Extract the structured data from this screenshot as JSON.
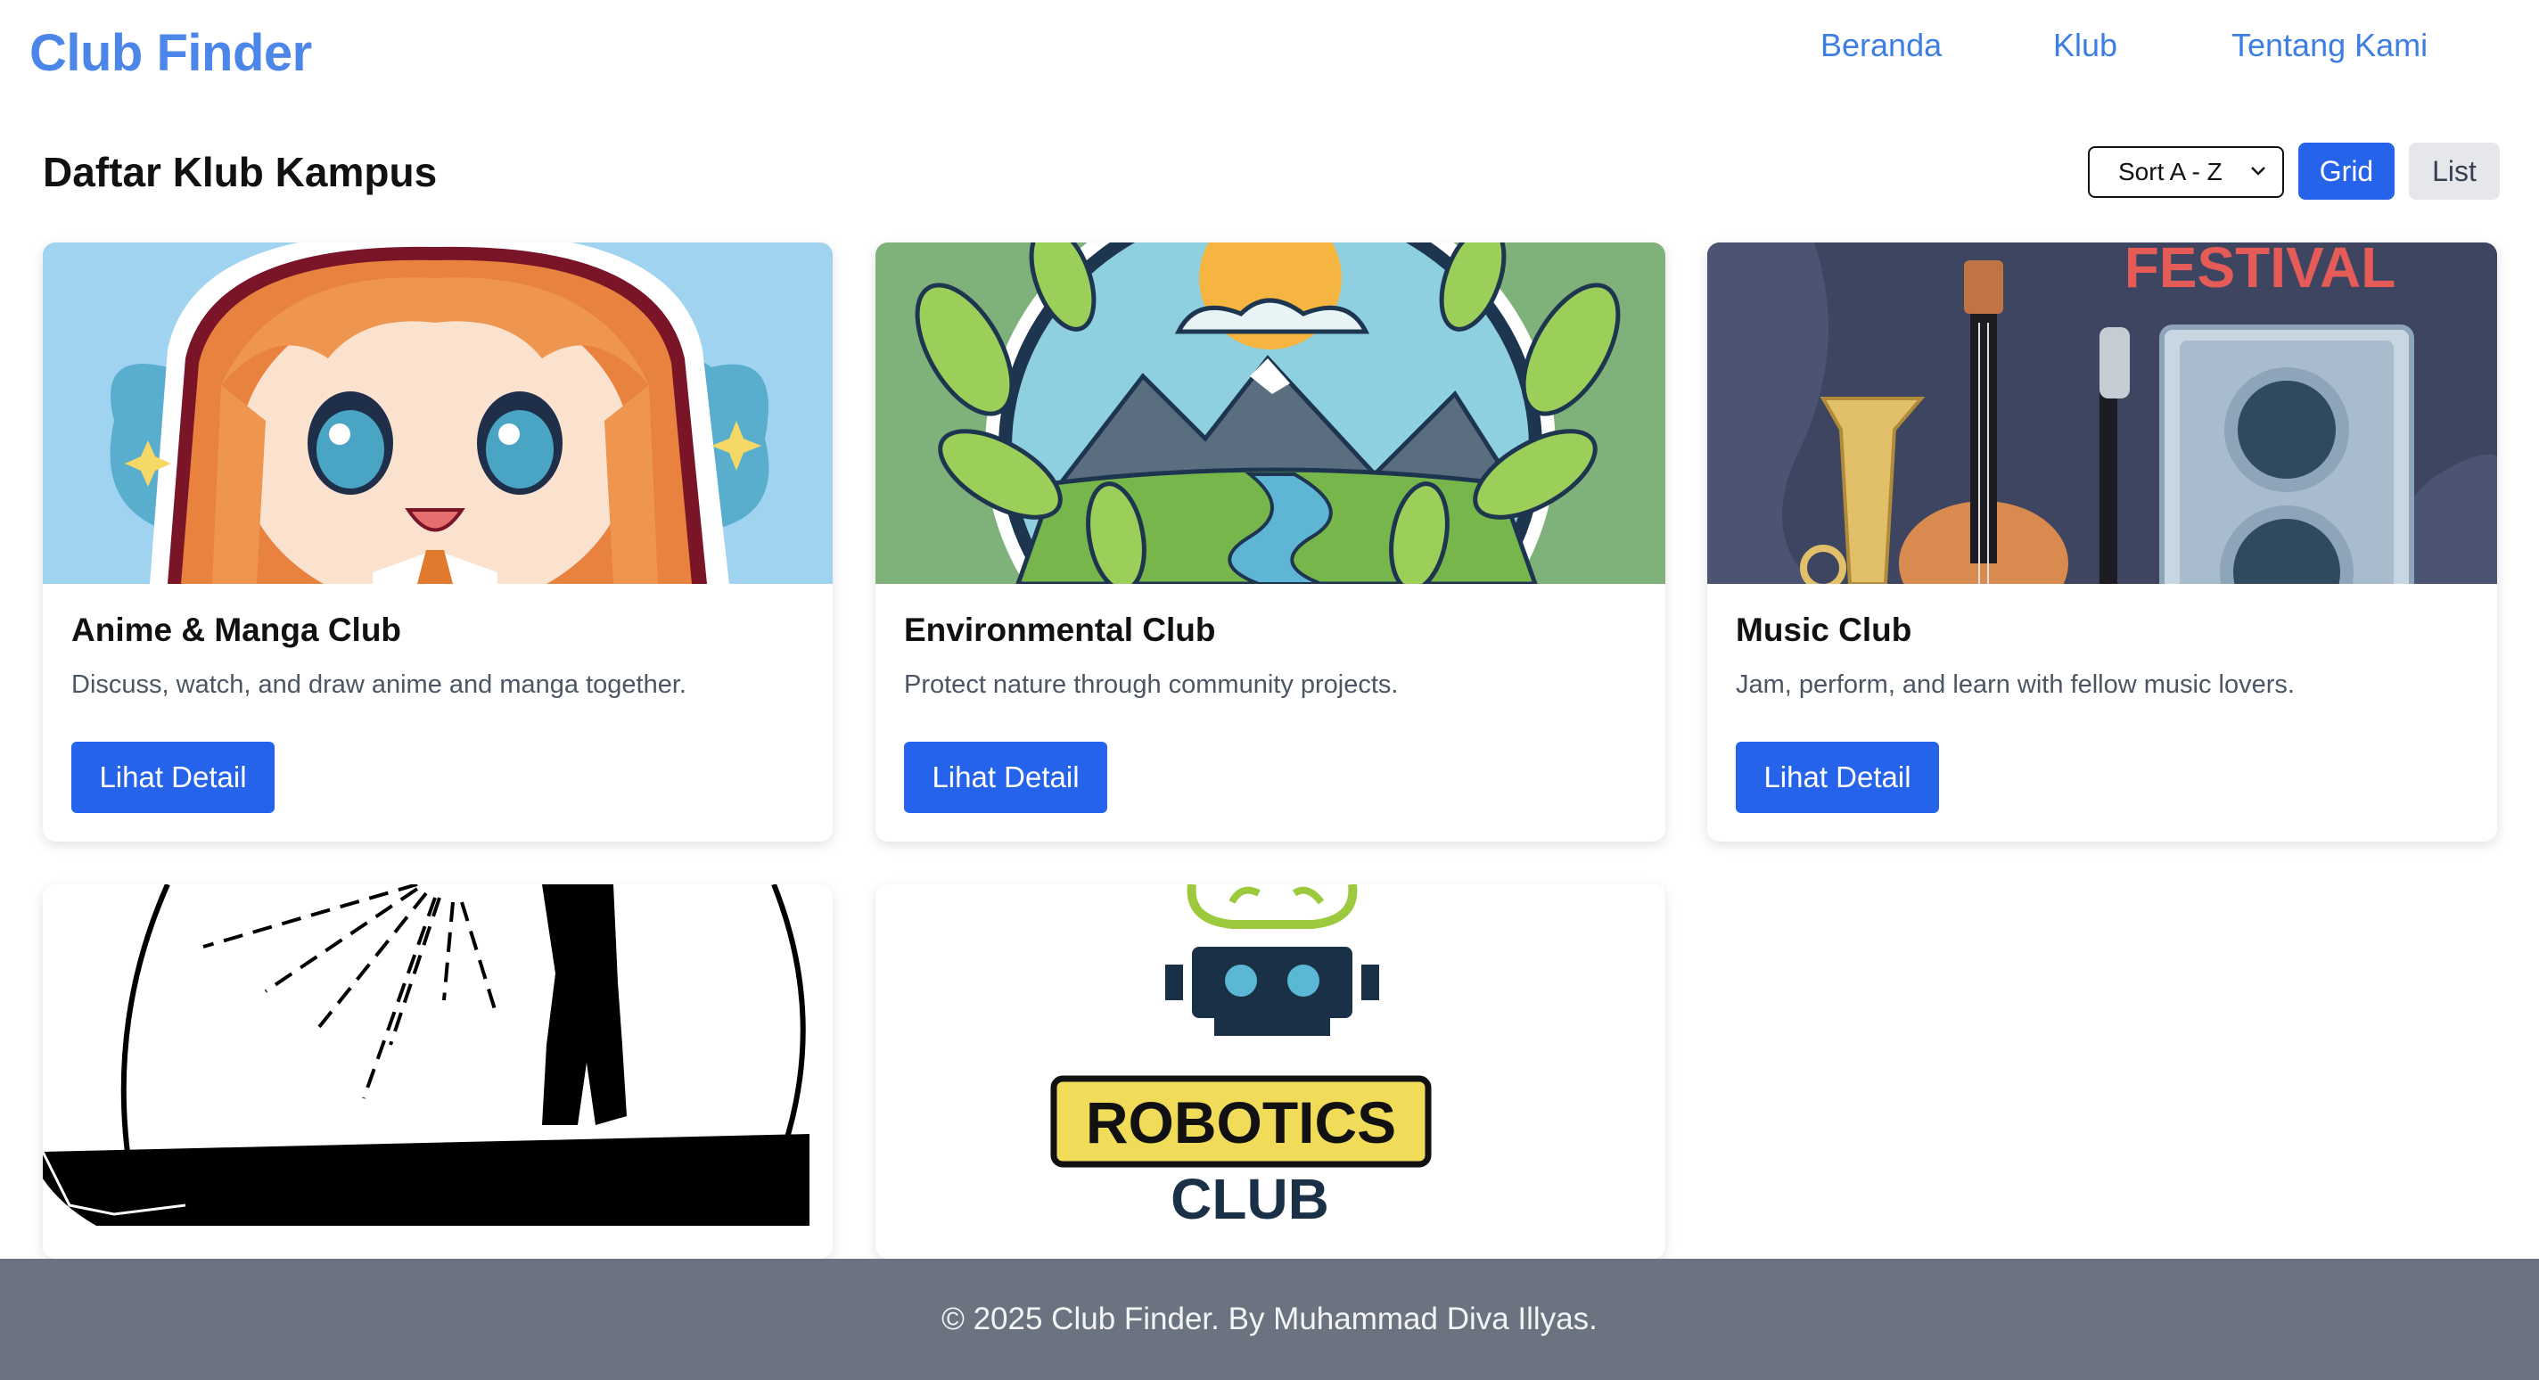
{
  "header": {
    "brand": "Club Finder",
    "nav": [
      "Beranda",
      "Klub",
      "Tentang Kami"
    ]
  },
  "toolbar": {
    "page_title": "Daftar Klub Kampus",
    "sort_value": "Sort A - Z",
    "grid_label": "Grid",
    "list_label": "List"
  },
  "clubs": [
    {
      "name": "Anime & Manga Club",
      "description": "Discuss, watch, and draw anime and manga together.",
      "button": "Lihat Detail",
      "image": "anime-girl-illustration"
    },
    {
      "name": "Environmental Club",
      "description": "Protect nature through community projects.",
      "button": "Lihat Detail",
      "image": "nature-emblem-illustration"
    },
    {
      "name": "Music Club",
      "description": "Jam, perform, and learn with fellow music lovers.",
      "button": "Lihat Detail",
      "image": "music-festival-illustration",
      "image_text": "FESTIVAL"
    },
    {
      "image": "cliff-silhouette-illustration"
    },
    {
      "image": "robotics-logo",
      "image_text_1": "ROBOTICS",
      "image_text_2": "CLUB"
    }
  ],
  "footer": {
    "text": "© 2025 Club Finder. By Muhammad Diva Illyas."
  },
  "colors": {
    "brand": "#4b86e8",
    "primary": "#2563eb",
    "footer_bg": "#6b7280"
  }
}
